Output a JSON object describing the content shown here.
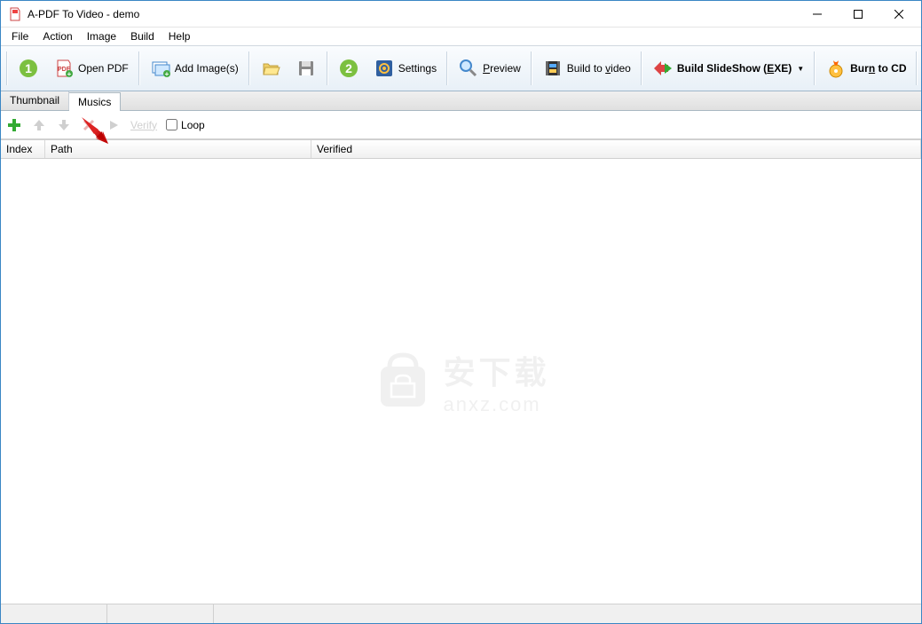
{
  "titlebar": {
    "title": "A-PDF To Video - demo"
  },
  "menu": {
    "file": "File",
    "action": "Action",
    "image": "Image",
    "build": "Build",
    "help": "Help"
  },
  "toolbar": {
    "open_pdf": "Open PDF",
    "add_images": "Add Image(s)",
    "settings": "Settings",
    "preview": "Preview",
    "build_video": "Build to video",
    "build_slideshow": "Build SlideShow (EXE)",
    "burn_cd": "Burn to CD"
  },
  "tabs": {
    "thumbnail": "Thumbnail",
    "musics": "Musics"
  },
  "subbar": {
    "verify": "Verify",
    "loop": "Loop"
  },
  "columns": {
    "index": "Index",
    "path": "Path",
    "verified": "Verified"
  },
  "watermark": {
    "cn": "安下载",
    "en": "anxz.com"
  }
}
